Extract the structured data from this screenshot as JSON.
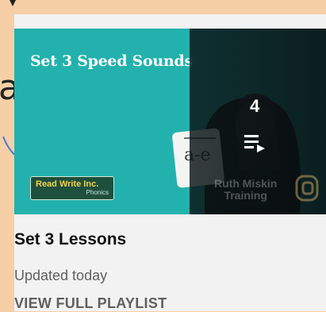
{
  "background_letter": "a",
  "thumbnail": {
    "title": "Set 3 Speed Sounds",
    "card_text": "a-e",
    "logo": {
      "main": "Read Write Inc.",
      "sub": "Phonics"
    },
    "watermark": [
      "Ruth Miskin",
      "Training"
    ],
    "video_count": "4",
    "playlist_icon": "playlist-play-icon"
  },
  "playlist": {
    "title": "Set 3 Lessons",
    "updated": "Updated today",
    "view_full": "VIEW FULL PLAYLIST"
  },
  "colors": {
    "page_bg": "#f6cfa6",
    "card_bg": "#f2f2f2",
    "thumb_teal": "#22b1ac",
    "annotation_blue": "#4a7bd1"
  }
}
